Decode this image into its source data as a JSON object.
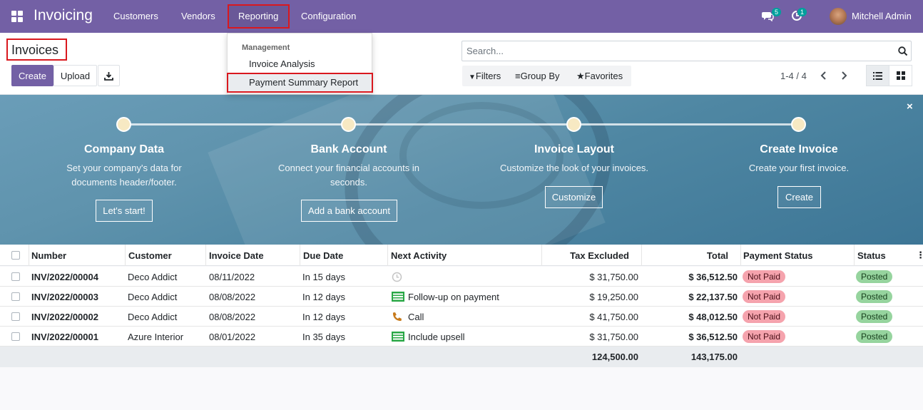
{
  "topbar": {
    "app_title": "Invoicing",
    "menu": [
      "Customers",
      "Vendors",
      "Reporting",
      "Configuration"
    ],
    "messages_count": "5",
    "activities_count": "1",
    "user_name": "Mitchell Admin"
  },
  "dropdown": {
    "section": "Management",
    "items": [
      "Invoice Analysis",
      "Payment Summary Report"
    ]
  },
  "control_panel": {
    "title": "Invoices",
    "create_label": "Create",
    "upload_label": "Upload",
    "search_placeholder": "Search...",
    "filters_label": "Filters",
    "group_by_label": "Group By",
    "favorites_label": "Favorites",
    "pager": "1-4 / 4"
  },
  "onboarding": {
    "close": "×",
    "steps": [
      {
        "title": "Company Data",
        "desc": "Set your company's data for documents header/footer.",
        "button": "Let's start!"
      },
      {
        "title": "Bank Account",
        "desc": "Connect your financial accounts in seconds.",
        "button": "Add a bank account"
      },
      {
        "title": "Invoice Layout",
        "desc": "Customize the look of your invoices.",
        "button": "Customize"
      },
      {
        "title": "Create Invoice",
        "desc": "Create your first invoice.",
        "button": "Create"
      }
    ]
  },
  "table": {
    "columns": [
      "Number",
      "Customer",
      "Invoice Date",
      "Due Date",
      "Next Activity",
      "Tax Excluded",
      "Total",
      "Payment Status",
      "Status"
    ],
    "rows": [
      {
        "number": "INV/2022/00004",
        "customer": "Deco Addict",
        "invoice_date": "08/11/2022",
        "due_date": "In 15 days",
        "activity": "",
        "activity_icon": "clock-icon",
        "tax_excluded": "$ 31,750.00",
        "total": "$ 36,512.50",
        "payment_status": "Not Paid",
        "status": "Posted"
      },
      {
        "number": "INV/2022/00003",
        "customer": "Deco Addict",
        "invoice_date": "08/08/2022",
        "due_date": "In 12 days",
        "activity": "Follow-up on payment",
        "activity_icon": "todo-list-icon",
        "tax_excluded": "$ 19,250.00",
        "total": "$ 22,137.50",
        "payment_status": "Not Paid",
        "status": "Posted"
      },
      {
        "number": "INV/2022/00002",
        "customer": "Deco Addict",
        "invoice_date": "08/08/2022",
        "due_date": "In 12 days",
        "activity": "Call",
        "activity_icon": "phone-icon",
        "tax_excluded": "$ 41,750.00",
        "total": "$ 48,012.50",
        "payment_status": "Not Paid",
        "status": "Posted"
      },
      {
        "number": "INV/2022/00001",
        "customer": "Azure Interior",
        "invoice_date": "08/01/2022",
        "due_date": "In 35 days",
        "activity": "Include upsell",
        "activity_icon": "todo-list-icon",
        "tax_excluded": "$ 31,750.00",
        "total": "$ 36,512.50",
        "payment_status": "Not Paid",
        "status": "Posted"
      }
    ],
    "sum_tax_excluded": "124,500.00",
    "sum_total": "143,175.00"
  },
  "colors": {
    "brand": "#7360a5",
    "highlight_border": "#d9181e",
    "not_paid": "#f5a3ad",
    "posted": "#96d49e"
  }
}
